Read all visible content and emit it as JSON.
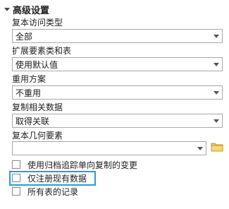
{
  "section": {
    "title": "高级设置"
  },
  "fields": {
    "replica_access_type": {
      "label": "复本访问类型",
      "value": "全部"
    },
    "extend_feature_classes": {
      "label": "扩展要素类和表",
      "value": "使用默认值"
    },
    "reuse_schema": {
      "label": "重用方案",
      "value": "不重用"
    },
    "replicate_related": {
      "label": "复制相关数据",
      "value": "取得关联"
    },
    "replica_geometry": {
      "label": "复本几何要素",
      "value": ""
    }
  },
  "checkboxes": {
    "archive_one_way": {
      "label": "使用归档追踪单向复制的变更",
      "checked": false
    },
    "register_existing": {
      "label": "仅注册现有数据",
      "checked": false
    },
    "all_records": {
      "label": "所有表的记录",
      "checked": false
    }
  },
  "colors": {
    "highlight": "#1ba1e2",
    "folder": "#e8b84a"
  },
  "icons": {
    "section_toggle": "chevron-down-icon",
    "browse": "folder-icon",
    "dropdown": "dropdown-arrow-icon"
  }
}
